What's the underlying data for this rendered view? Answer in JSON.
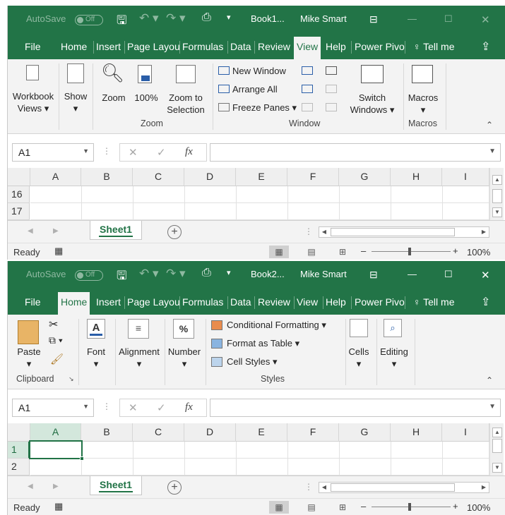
{
  "windows": [
    {
      "autosave": "AutoSave",
      "toggle": "Off",
      "book": "Book1...",
      "user": "Mike Smart",
      "tabs": [
        "File",
        "Home",
        "Insert",
        "Page Layou",
        "Formulas",
        "Data",
        "Review",
        "View",
        "Help",
        "Power Pivo",
        "Tell me"
      ],
      "active_tab": "View",
      "ribbon": {
        "workbook_views": "Workbook\nViews ▾",
        "show": "Show\n▾",
        "zoom": "Zoom",
        "zoom100": "100%",
        "zoom_sel": "Zoom to\nSelection",
        "new_window": "New Window",
        "arrange_all": "Arrange All",
        "freeze_panes": "Freeze Panes ▾",
        "switch_windows": "Switch\nWindows ▾",
        "macros": "Macros\n▾",
        "groups": [
          "Zoom",
          "Window",
          "Macros"
        ]
      },
      "namebox": "A1",
      "columns": [
        "A",
        "B",
        "C",
        "D",
        "E",
        "F",
        "G",
        "H",
        "I"
      ],
      "rows": [
        "16",
        "17"
      ],
      "sheet": "Sheet1",
      "status": "Ready",
      "zoom_pct": "100%"
    },
    {
      "autosave": "AutoSave",
      "toggle": "Off",
      "book": "Book2...",
      "user": "Mike Smart",
      "tabs": [
        "File",
        "Home",
        "Insert",
        "Page Layou",
        "Formulas",
        "Data",
        "Review",
        "View",
        "Help",
        "Power Pivo",
        "Tell me"
      ],
      "active_tab": "Home",
      "ribbon": {
        "paste": "Paste\n▾",
        "font": "Font\n▾",
        "alignment": "Alignment\n▾",
        "number": "Number\n▾",
        "cond_fmt": "Conditional Formatting ▾",
        "fmt_table": "Format as Table ▾",
        "cell_styles": "Cell Styles ▾",
        "cells": "Cells\n▾",
        "editing": "Editing\n▾",
        "groups": [
          "Clipboard",
          "Styles"
        ]
      },
      "namebox": "A1",
      "columns": [
        "A",
        "B",
        "C",
        "D",
        "E",
        "F",
        "G",
        "H",
        "I"
      ],
      "rows": [
        "1",
        "2"
      ],
      "sheet": "Sheet1",
      "status": "Ready",
      "zoom_pct": "100%"
    }
  ],
  "colors": {
    "excel_green": "#227447",
    "ribbon_bg": "#f3f3f3"
  }
}
